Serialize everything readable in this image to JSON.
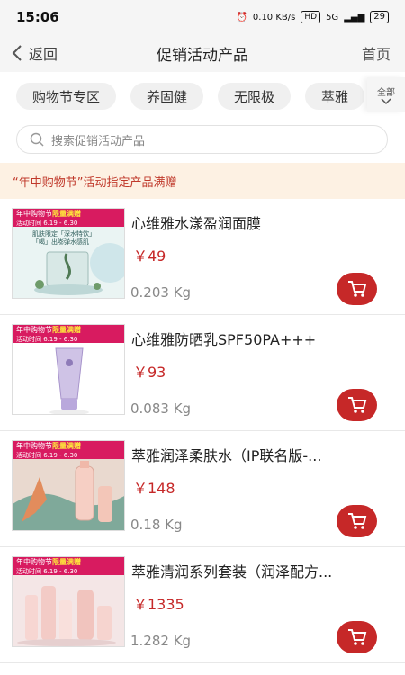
{
  "status": {
    "time": "15:06",
    "network": "0.10 KB/s",
    "hd": "HD",
    "signal": "5G",
    "battery": "29"
  },
  "nav": {
    "back": "返回",
    "title": "促销活动产品",
    "home": "首页"
  },
  "tabs": [
    "购物节专区",
    "养固健",
    "无限极",
    "萃雅"
  ],
  "all_label": "全部",
  "search": {
    "placeholder": "搜索促销活动产品"
  },
  "promo": "“年中购物节”活动指定产品满赠",
  "thumb_banner": {
    "left": "年中购物节",
    "right": "限量满赠",
    "sub": "活动时间 6.19 - 6.30"
  },
  "products": [
    {
      "name": "心维雅水漾盈润面膜",
      "price": "￥49",
      "weight": "0.203 Kg"
    },
    {
      "name": "心维雅防晒乳SPF50PA+++",
      "price": "￥93",
      "weight": "0.083 Kg"
    },
    {
      "name": "萃雅润泽柔肤水（IP联名版-...",
      "price": "￥148",
      "weight": "0.18 Kg"
    },
    {
      "name": "萃雅清润系列套装（润泽配方...",
      "price": "￥1335",
      "weight": "1.282 Kg"
    }
  ],
  "thumb1_text": [
    "肌肤限定「深水特饮」",
    "「喝」出嘭弹水感肌"
  ]
}
